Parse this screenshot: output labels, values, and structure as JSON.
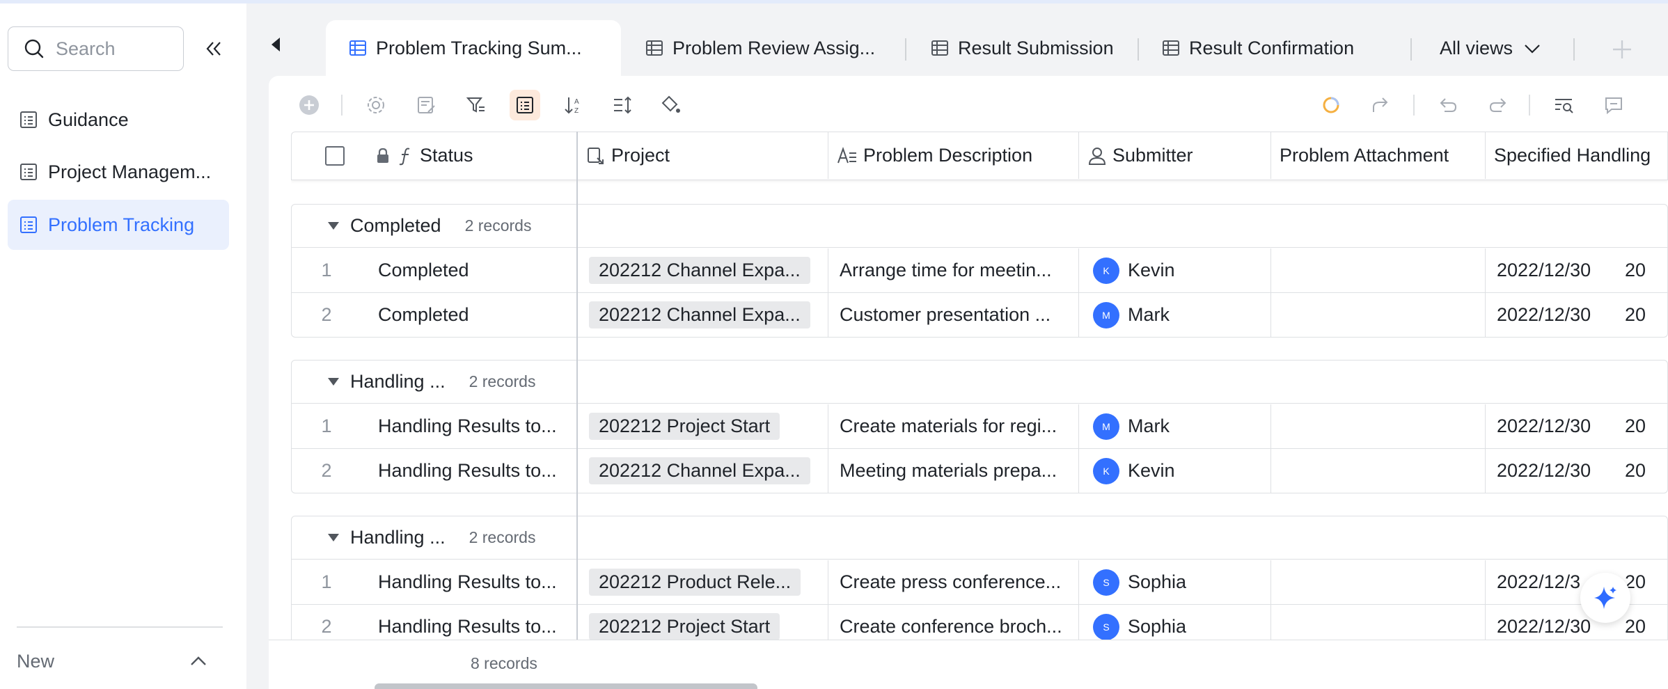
{
  "sidebar": {
    "search_placeholder": "Search",
    "items": [
      {
        "label": "Guidance",
        "icon": "table-doc-icon",
        "active": false
      },
      {
        "label": "Project Managem...",
        "icon": "table-doc-icon",
        "active": false
      },
      {
        "label": "Problem Tracking",
        "icon": "table-doc-icon",
        "active": true
      }
    ],
    "new_label": "New"
  },
  "tabs": [
    {
      "label": "Problem Tracking Sum...",
      "active": true
    },
    {
      "label": "Problem Review Assig...",
      "active": false
    },
    {
      "label": "Result Submission",
      "active": false
    },
    {
      "label": "Result Confirmation",
      "active": false
    }
  ],
  "all_views_label": "All views",
  "columns": {
    "status": "Status",
    "project": "Project",
    "description": "Problem Description",
    "submitter": "Submitter",
    "attachment": "Problem Attachment",
    "handling": "Specified Handling"
  },
  "groups": [
    {
      "name": "Completed",
      "count": "2 records",
      "rows": [
        {
          "num": "1",
          "status": "Completed",
          "project": "202212 Channel Expa...",
          "description": "Arrange time for meetin...",
          "submitter": "Kevin",
          "initial": "K",
          "date": "2022/12/30",
          "extra": "20"
        },
        {
          "num": "2",
          "status": "Completed",
          "project": "202212 Channel Expa...",
          "description": "Customer presentation ...",
          "submitter": "Mark",
          "initial": "M",
          "date": "2022/12/30",
          "extra": "20"
        }
      ]
    },
    {
      "name": "Handling ...",
      "count": "2 records",
      "rows": [
        {
          "num": "1",
          "status": "Handling Results to...",
          "project": "202212 Project Start",
          "description": "Create materials for regi...",
          "submitter": "Mark",
          "initial": "M",
          "date": "2022/12/30",
          "extra": "20"
        },
        {
          "num": "2",
          "status": "Handling Results to...",
          "project": "202212 Channel Expa...",
          "description": "Meeting materials prepa...",
          "submitter": "Kevin",
          "initial": "K",
          "date": "2022/12/30",
          "extra": "20"
        }
      ]
    },
    {
      "name": "Handling ...",
      "count": "2 records",
      "rows": [
        {
          "num": "1",
          "status": "Handling Results to...",
          "project": "202212 Product Rele...",
          "description": "Create press conference...",
          "submitter": "Sophia",
          "initial": "S",
          "date": "2022/12/3",
          "extra": "20"
        },
        {
          "num": "2",
          "status": "Handling Results to...",
          "project": "202212 Project Start",
          "description": "Create conference broch...",
          "submitter": "Sophia",
          "initial": "S",
          "date": "2022/12/30",
          "extra": "20"
        }
      ]
    }
  ],
  "footer_count": "8 records",
  "colors": {
    "accent": "#3370ff",
    "active_bg": "#eaf0fd",
    "avatar": "#3370ff",
    "toolbar_active": "#fde9dc"
  }
}
